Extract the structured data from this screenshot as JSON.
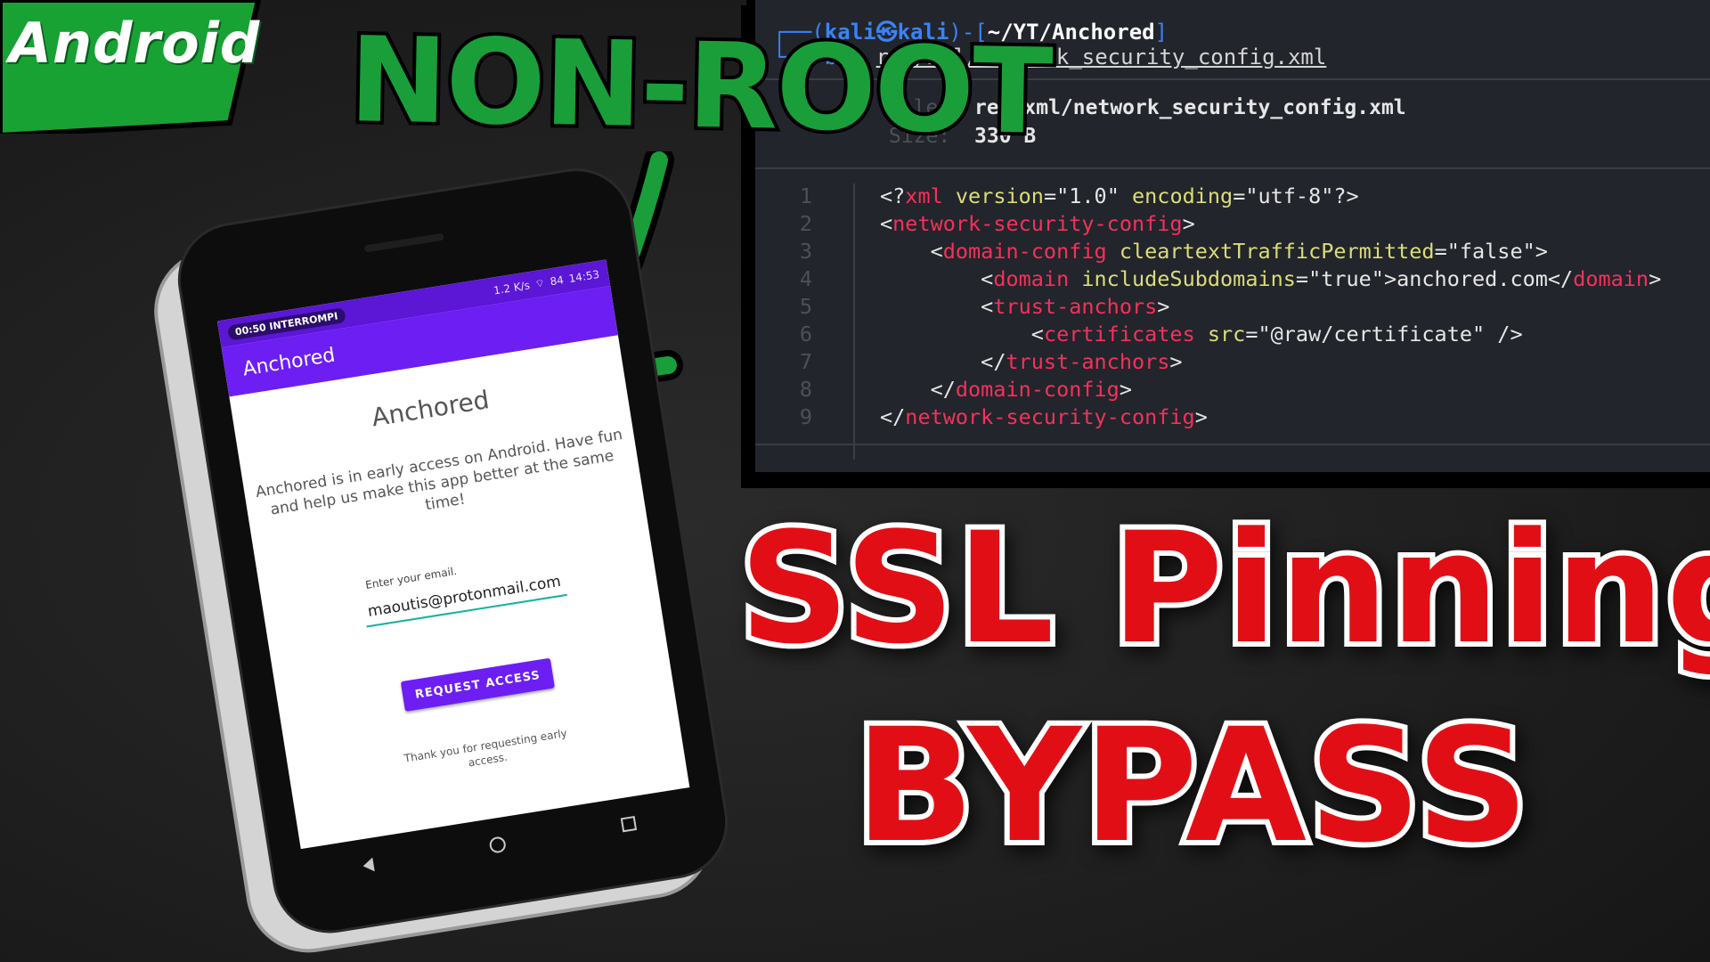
{
  "badge": {
    "label": "Android",
    "color": "#18a234"
  },
  "nonroot": {
    "text": "NON-ROOT"
  },
  "terminal": {
    "prompt": {
      "dash": "┌──(",
      "user": "kali㉿kali",
      "close": ")-[",
      "path": "~/YT/Anchored",
      "end": "]"
    },
    "command": {
      "cmd": "└─$ bat ",
      "arg": "res/xml/network_security_config.xml"
    },
    "file_label": "File:",
    "file": "res/xml/network_security_config.xml",
    "size_label": "Size:",
    "size": "330 B",
    "lines": [
      {
        "n": "1",
        "html_parts": [
          [
            "c-sym",
            "<?"
          ],
          [
            "c-tag",
            "xml"
          ],
          [
            "c-sym",
            " "
          ],
          [
            "c-attr",
            "version"
          ],
          [
            "c-sym",
            "=\"1.0\" "
          ],
          [
            "c-attr",
            "encoding"
          ],
          [
            "c-sym",
            "=\"utf-8\"?>"
          ]
        ]
      },
      {
        "n": "2",
        "html_parts": [
          [
            "c-sym",
            "<"
          ],
          [
            "c-tag",
            "network-security-config"
          ],
          [
            "c-sym",
            ">"
          ]
        ]
      },
      {
        "n": "3",
        "html_parts": [
          [
            "c-sym",
            "    <"
          ],
          [
            "c-tag",
            "domain-config"
          ],
          [
            "c-sym",
            " "
          ],
          [
            "c-attr",
            "cleartextTrafficPermitted"
          ],
          [
            "c-sym",
            "=\"false\">"
          ]
        ]
      },
      {
        "n": "4",
        "html_parts": [
          [
            "c-sym",
            "        <"
          ],
          [
            "c-tag",
            "domain"
          ],
          [
            "c-sym",
            " "
          ],
          [
            "c-attr",
            "includeSubdomains"
          ],
          [
            "c-sym",
            "=\"true\">anchored.com</"
          ],
          [
            "c-tag",
            "domain"
          ],
          [
            "c-sym",
            ">"
          ]
        ]
      },
      {
        "n": "5",
        "html_parts": [
          [
            "c-sym",
            "        <"
          ],
          [
            "c-tag",
            "trust-anchors"
          ],
          [
            "c-sym",
            ">"
          ]
        ]
      },
      {
        "n": "6",
        "html_parts": [
          [
            "c-sym",
            "            <"
          ],
          [
            "c-tag",
            "certificates"
          ],
          [
            "c-sym",
            " "
          ],
          [
            "c-attr",
            "src"
          ],
          [
            "c-sym",
            "=\"@raw/certificate\" />"
          ]
        ]
      },
      {
        "n": "7",
        "html_parts": [
          [
            "c-sym",
            "        </"
          ],
          [
            "c-tag",
            "trust-anchors"
          ],
          [
            "c-sym",
            ">"
          ]
        ]
      },
      {
        "n": "8",
        "html_parts": [
          [
            "c-sym",
            "    </"
          ],
          [
            "c-tag",
            "domain-config"
          ],
          [
            "c-sym",
            ">"
          ]
        ]
      },
      {
        "n": "9",
        "html_parts": [
          [
            "c-sym",
            "</"
          ],
          [
            "c-tag",
            "network-security-config"
          ],
          [
            "c-sym",
            ">"
          ]
        ]
      }
    ]
  },
  "title": {
    "line1": "SSL Pinning",
    "line2": "BYPASS",
    "color": "#e10f15"
  },
  "phone": {
    "status": {
      "time": "00:50",
      "carrier": "INTERROMPI",
      "speed": "1.2 K/s",
      "battery": "84",
      "clock": "14:53"
    },
    "app_bar_title": "Anchored",
    "heading": "Anchored",
    "description": "Anchored is in early access on Android. Have fun and help us make this app better at the same time!",
    "email_label": "Enter your email.",
    "email_value": "maoutis@protonmail.com",
    "button_label": "REQUEST ACCESS",
    "thanks": "Thank you for requesting early access.",
    "accent": "#6d1ef3"
  }
}
